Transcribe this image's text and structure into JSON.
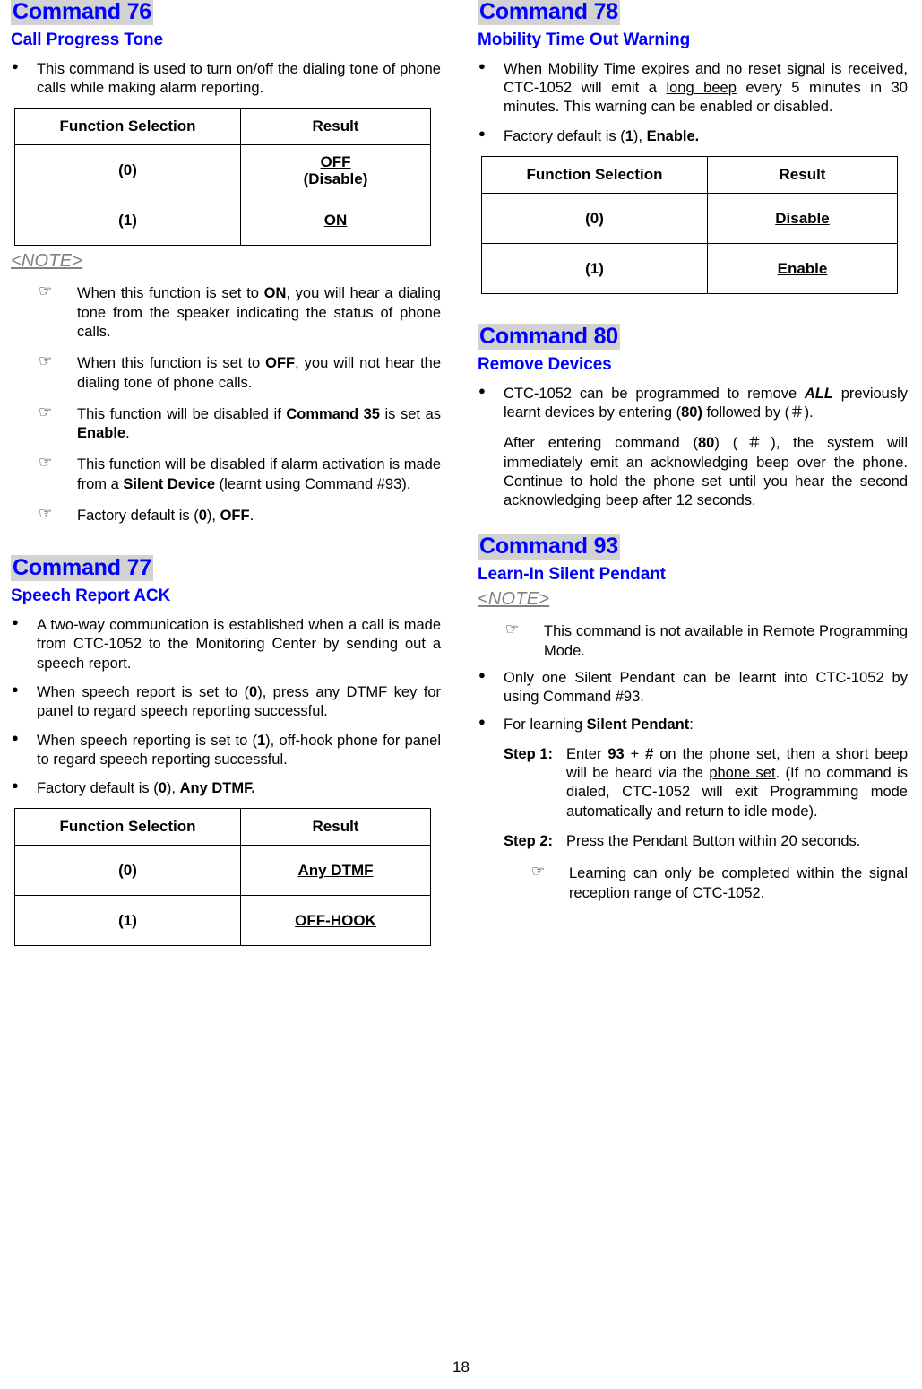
{
  "page": {
    "number": "18"
  },
  "labels": {
    "note": "<NOTE>",
    "table_header_function": "Function Selection",
    "table_header_result": "Result",
    "opt_0": "(0)",
    "opt_1": "(1)",
    "step1_label": "Step 1:",
    "step2_label": "Step 2:"
  },
  "left_column": {
    "command76": {
      "heading": "Command 76",
      "subheading": "Call Progress Tone",
      "bullets": [
        "This command is used to turn on/off the dialing tone of phone calls while making alarm reporting."
      ],
      "table": {
        "headers": [
          "Function Selection",
          "Result"
        ],
        "rows": [
          {
            "selection": "(0)",
            "result_underlined": "OFF",
            "result_second_line": "(Disable)"
          },
          {
            "selection": "(1)",
            "result_underlined": "ON",
            "result_second_line": ""
          }
        ]
      },
      "notes": [
        {
          "pre": "When this function is set to ",
          "bold1": "ON",
          "post": ", you will hear a dialing tone from the speaker indicating the status of phone calls."
        },
        {
          "pre": "When this function is set to ",
          "bold1": "OFF",
          "post": ", you will not hear the dialing tone of phone calls."
        },
        {
          "pre": "This function will be disabled if ",
          "bold1": "Command 35",
          "mid": " is set as ",
          "bold2": "Enable",
          "post": "."
        },
        {
          "pre": "This function will be disabled if alarm activation is made from a ",
          "bold1": "Silent Device",
          "post": " (learnt using Command #93)."
        },
        {
          "pre": "Factory default is (",
          "bold1": "0",
          "mid": "), ",
          "bold2": "OFF",
          "post": "."
        }
      ]
    },
    "command77": {
      "heading": "Command 77",
      "subheading": "Speech Report ACK",
      "bullets": [
        {
          "pre": "A two-way communication is established when a call is made from CTC-1052 to the Monitoring Center by sending out a speech report."
        },
        {
          "pre": "When speech report is set to (",
          "bold1": "0",
          "post": "), press any DTMF key for panel to regard speech reporting successful."
        },
        {
          "pre": "When speech reporting is set to (",
          "bold1": "1",
          "post": "), off-hook phone for panel to regard speech reporting successful."
        },
        {
          "pre": "Factory default is (",
          "bold1": "0",
          "mid": "), ",
          "bold2": "Any DTMF.",
          "post": ""
        }
      ],
      "table": {
        "headers": [
          "Function Selection",
          "Result"
        ],
        "rows": [
          {
            "selection": "(0)",
            "result_underlined": "Any DTMF",
            "result_second_line": ""
          },
          {
            "selection": "(1)",
            "result_underlined": "OFF-HOOK",
            "result_second_line": ""
          }
        ]
      }
    }
  },
  "right_column": {
    "command78": {
      "heading": "Command 78",
      "subheading": "Mobility Time Out Warning",
      "bullet1": {
        "pre": "When Mobility Time expires and no reset signal is received, CTC-1052 will emit a ",
        "underlined": "long beep",
        "post": " every 5 minutes in 30 minutes. This warning can be enabled or disabled."
      },
      "bullet2": {
        "pre": "Factory default is (",
        "bold1": "1",
        "mid": "), ",
        "bold2": "Enable.",
        "post": ""
      },
      "table": {
        "headers": [
          "Function Selection",
          "Result"
        ],
        "rows": [
          {
            "selection": "(0)",
            "result_underlined": "Disable",
            "result_second_line": ""
          },
          {
            "selection": "(1)",
            "result_underlined": "Enable",
            "result_second_line": ""
          }
        ]
      }
    },
    "command80": {
      "heading": "Command 80",
      "subheading": "Remove Devices",
      "bullet1": {
        "pre": "CTC-1052 can be programmed to remove ",
        "bold_italic": "ALL",
        "mid": " previously learnt devices by entering (",
        "bold1": "80)",
        "post": " followed by (＃)."
      },
      "paragraph": {
        "pre": "After entering command (",
        "bold1": "80",
        "mid": ") (＃), the system will immediately emit an acknowledging beep over the phone. Continue to hold the phone set until you hear the second acknowledging beep after 12 seconds."
      }
    },
    "command93": {
      "heading": "Command 93",
      "subheading": "Learn-In Silent Pendant",
      "note_label": "<NOTE>",
      "note1": "This command is not available in Remote Programming Mode.",
      "bullet1": "Only one Silent Pendant can be learnt into CTC-1052 by using Command #93.",
      "bullet2": {
        "pre": "For learning ",
        "bold1": "Silent Pendant",
        "post": ":"
      },
      "step1": {
        "label": "Step 1:",
        "pre": "Enter ",
        "bold1": "93",
        "mid1": " + ",
        "bold2": "#",
        "mid2": " on the phone set, then a short beep will be heard via the ",
        "underlined": "phone set",
        "post": ". (If no command is dialed, CTC-1052 will exit Programming mode automatically and return to idle mode)."
      },
      "step2": {
        "label": "Step 2:",
        "text": "Press the Pendant Button within 20 seconds."
      },
      "note2": "Learning can only be completed within the signal reception range of CTC-1052."
    }
  }
}
